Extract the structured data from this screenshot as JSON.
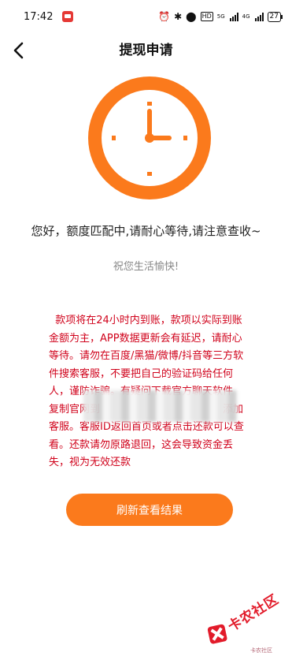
{
  "status_bar": {
    "time": "17:42",
    "network_label": "5G",
    "network_label_2": "4G",
    "hd_label": "HD",
    "battery": "27",
    "icons": [
      "app-notification-icon",
      "alarm-icon",
      "bluetooth-icon",
      "location-icon",
      "hd-icon",
      "signal-icon",
      "battery-icon"
    ]
  },
  "header": {
    "title": "提现申请",
    "back_icon": "chevron-left-icon"
  },
  "hero": {
    "icon": "clock-icon",
    "accent_color": "#fb7a1c",
    "message": "您好，额度匹配中,请耐心等待,请注意查收~",
    "wish": "祝您生活愉快!"
  },
  "notice": {
    "text": "  款项将在24小时内到账，款项以实际到账金额为主，APP数据更新会有延迟，请耐心等待。请勿在百度/黑猫/微博/抖音等三方软件搜索客服，不要把自己的验证码给任何人，谨防诈骗。有疑问下载官方聊天软件　　　　　复制官网到　　　　　　　　　　　　添加客服。客服ID返回首页或者点击还款可以查看。还款请勿原路退回，这会导致资金丢失，视为无效还款",
    "color": "#d0021b"
  },
  "actions": {
    "refresh_label": "刷新查看结果"
  },
  "watermark": {
    "text": "卡农社区",
    "sub": "卡农社区"
  }
}
